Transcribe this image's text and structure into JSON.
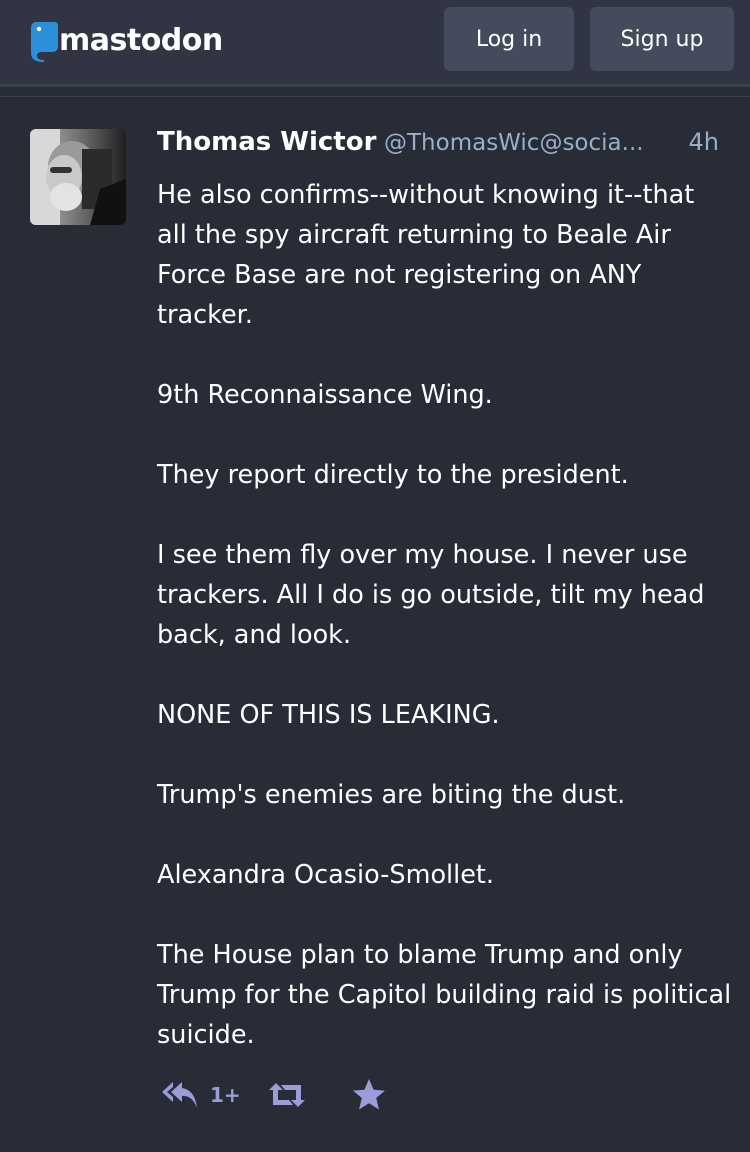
{
  "header": {
    "logo_text": "mastodon",
    "login_label": "Log in",
    "signup_label": "Sign up"
  },
  "status": {
    "display_name": "Thomas Wictor",
    "acct": "@ThomasWic@socia...",
    "time": "4h",
    "paragraphs": [
      "He also confirms--without knowing it--that all the spy aircraft returning to Beale Air Force Base are not registering on ANY tracker.",
      "9th Reconnaissance Wing.",
      "They report directly to the president.",
      "I see them fly over my house. I never use trackers. All I do is go outside, tilt my head back, and look.",
      "NONE OF THIS IS LEAKING.",
      "Trump's enemies are biting the dust.",
      "Alexandra Ocasio-Smollet.",
      "The House plan to blame Trump and only Trump for the Capitol building raid is political suicide."
    ],
    "reply_count": "1+"
  },
  "icons": {
    "logo": "mastodon-logo-icon",
    "reply": "reply-all-icon",
    "boost": "boost-icon",
    "favourite": "star-icon"
  },
  "colors": {
    "background": "#282c37",
    "header": "#313543",
    "button": "#444b5d",
    "muted_text": "#9baec8",
    "action_icon": "#9d9bd8",
    "logo_blue": "#2b90d9"
  }
}
